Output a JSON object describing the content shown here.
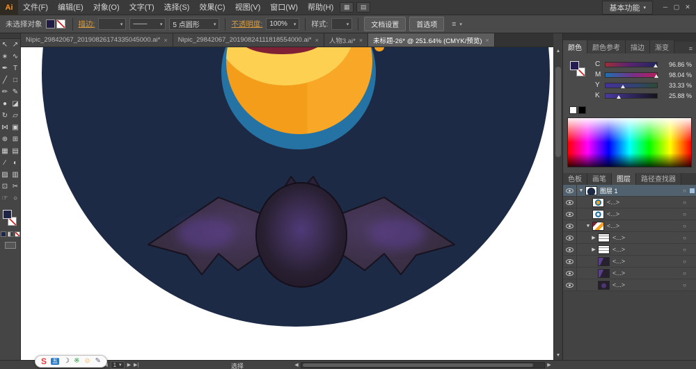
{
  "window": {
    "logo": "Ai",
    "workspace": "基本功能",
    "controls": [
      "─",
      "▢",
      "✕"
    ]
  },
  "ui": {
    "caret": "▾",
    "menu": "≡",
    "up_arrow": "▲",
    "down_arrow": "▼",
    "left_arrow": "◀",
    "right_arrow": "▶"
  },
  "menubar": {
    "items": [
      "文件(F)",
      "编辑(E)",
      "对象(O)",
      "文字(T)",
      "选择(S)",
      "效果(C)",
      "视图(V)",
      "窗口(W)",
      "帮助(H)"
    ],
    "mid_icons": [
      "▦",
      "▤"
    ]
  },
  "controlbar": {
    "no_selection": "未选择对象",
    "stroke_label": "描边:",
    "stroke_value": "",
    "width_profile": "——",
    "brush_name": "5 点圆形",
    "opacity_label": "不透明度:",
    "opacity_value": "100%",
    "style_label": "样式:",
    "doc_setup": "文档设置",
    "preferences": "首选项"
  },
  "tabs": {
    "close_glyph": "×",
    "items": [
      {
        "title": "Nipic_29842067_20190826174335045000.ai*",
        "active": false
      },
      {
        "title": "Nipic_29842067_20190824111818554000.ai*",
        "active": false
      },
      {
        "title": "人物3.ai*",
        "active": false
      },
      {
        "title": "未标题-26* @ 251.64% (CMYK/预览)",
        "active": true
      }
    ]
  },
  "tools": {
    "items": [
      {
        "name": "selection",
        "glyph": "↖"
      },
      {
        "name": "direct-selection",
        "glyph": "↗"
      },
      {
        "name": "magic-wand",
        "glyph": "∗"
      },
      {
        "name": "lasso",
        "glyph": "∿"
      },
      {
        "name": "pen",
        "glyph": "✒"
      },
      {
        "name": "type",
        "glyph": "T"
      },
      {
        "name": "line-segment",
        "glyph": "╱"
      },
      {
        "name": "rectangle",
        "glyph": "□"
      },
      {
        "name": "paintbrush",
        "glyph": "✏"
      },
      {
        "name": "pencil",
        "glyph": "✎"
      },
      {
        "name": "blob-brush",
        "glyph": "●"
      },
      {
        "name": "eraser",
        "glyph": "◪"
      },
      {
        "name": "rotate",
        "glyph": "↻"
      },
      {
        "name": "scale",
        "glyph": "▱"
      },
      {
        "name": "width",
        "glyph": "⋈"
      },
      {
        "name": "free-transform",
        "glyph": "▣"
      },
      {
        "name": "shape-builder",
        "glyph": "⊕"
      },
      {
        "name": "perspective-grid",
        "glyph": "⊞"
      },
      {
        "name": "mesh",
        "glyph": "▦"
      },
      {
        "name": "gradient",
        "glyph": "▤"
      },
      {
        "name": "eyedropper",
        "glyph": "∕"
      },
      {
        "name": "blend",
        "glyph": "◐"
      },
      {
        "name": "symbol-sprayer",
        "glyph": "▨"
      },
      {
        "name": "column-graph",
        "glyph": "▥"
      },
      {
        "name": "artboard",
        "glyph": "⊡"
      },
      {
        "name": "slice",
        "glyph": "✂"
      },
      {
        "name": "hand",
        "glyph": "☞"
      },
      {
        "name": "zoom",
        "glyph": "○"
      }
    ]
  },
  "color_panel": {
    "tabs": [
      "颜色",
      "颜色参考",
      "描边",
      "渐变"
    ],
    "active_tab": "颜色",
    "sliders": [
      {
        "channel": "C",
        "value": "96.86 %",
        "percent": 96.86
      },
      {
        "channel": "M",
        "value": "98.04 %",
        "percent": 98.04
      },
      {
        "channel": "Y",
        "value": "33.33 %",
        "percent": 33.33
      },
      {
        "channel": "K",
        "value": "25.88 %",
        "percent": 25.88
      }
    ]
  },
  "layers_panel": {
    "tabs": [
      "色板",
      "画笔",
      "图层",
      "路径查找器"
    ],
    "active_tab": "图层",
    "target_glyph": "○",
    "rows": [
      {
        "label": "图层 1",
        "exp": "▼",
        "selected": true
      },
      {
        "label": "<...>",
        "exp": ""
      },
      {
        "label": "<...>",
        "exp": ""
      },
      {
        "label": "<...>",
        "exp": "▼"
      },
      {
        "label": "<...>",
        "exp": "▶"
      },
      {
        "label": "<...>",
        "exp": "▶"
      },
      {
        "label": "<...>",
        "exp": ""
      },
      {
        "label": "<...>",
        "exp": ""
      },
      {
        "label": "<...>",
        "exp": ""
      }
    ]
  },
  "statusbar": {
    "nav": {
      "first": "|◀",
      "prev": "◀",
      "page": "1",
      "next": "▶",
      "last": "▶|"
    },
    "status": "选择"
  },
  "ime": {
    "icons": [
      {
        "name": "sogou-logo",
        "glyph": "S"
      },
      {
        "name": "input-mode",
        "glyph": "五"
      },
      {
        "name": "half-full-width-moon",
        "glyph": "☽"
      },
      {
        "name": "punctuation",
        "glyph": "※"
      },
      {
        "name": "emoji",
        "glyph": "☺"
      },
      {
        "name": "ime-toolbox",
        "glyph": "✎"
      }
    ]
  },
  "colors": {
    "accent_link_orange": "#d79a3c",
    "layer_selection_blue": "#51626e",
    "artwork_navy": "#1c2a45",
    "artwork_ring_blue": "#2573a5",
    "artwork_orange": "#f5a11f",
    "artwork_yellow": "#fdd052",
    "artwork_yellow_light": "#ffe48e",
    "artwork_maroon": "#7e2135",
    "bat_body_dark": "#241e2b",
    "bat_purple": "#4a356f"
  },
  "icons_css_only": [
    "fill-swatch-icon",
    "stroke-swatch-icon",
    "eye-icon",
    "gradient-swatch-icon",
    "none-swatch-icon"
  ]
}
